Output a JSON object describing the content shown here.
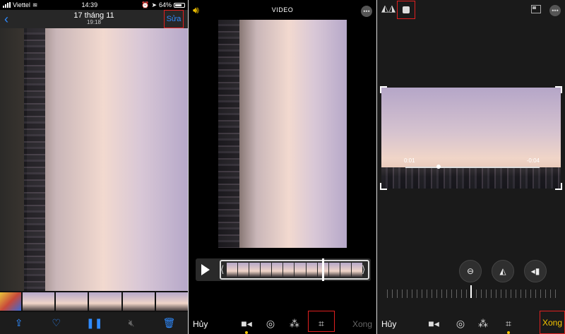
{
  "panel1": {
    "status": {
      "carrier": "Viettel",
      "time": "14:39",
      "battery": "64%"
    },
    "date": "17 tháng 11",
    "time": "19:18",
    "edit_label": "Sửa"
  },
  "panel2": {
    "title": "VIDEO",
    "cancel_label": "Hủy",
    "done_label": "Xong"
  },
  "panel3": {
    "time_start": "0:01",
    "time_end": "-0:04",
    "cancel_label": "Hủy",
    "done_label": "Xong"
  },
  "colors": {
    "accent_blue": "#2f8bff",
    "accent_yellow": "#f5c400",
    "highlight_red": "#e02020"
  }
}
